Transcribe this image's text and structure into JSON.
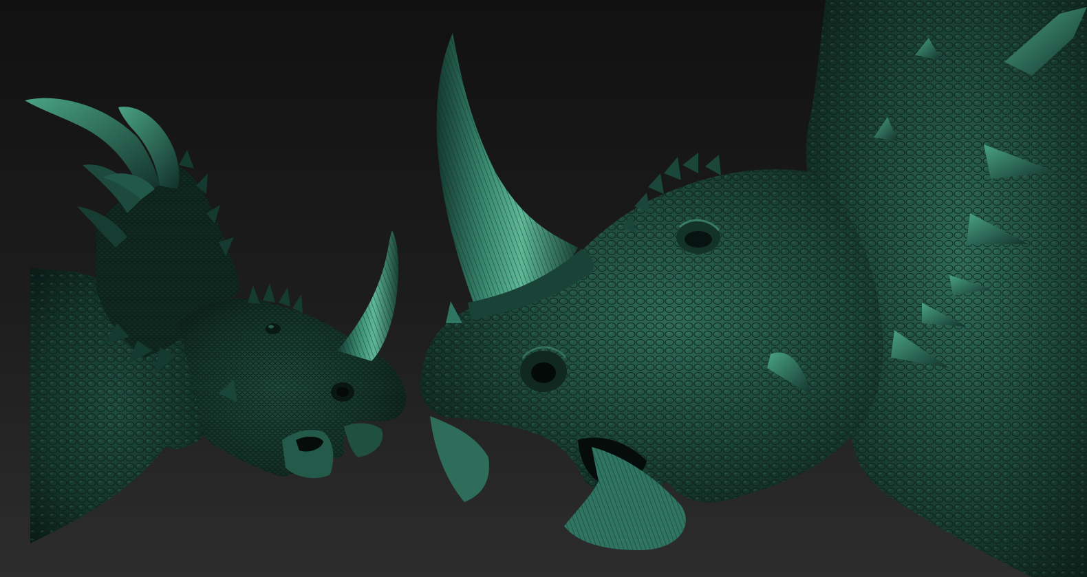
{
  "scene": {
    "subjects": [
      {
        "kind": "ceratopsian-head-bust",
        "view": "three-quarter"
      },
      {
        "kind": "ceratopsian-head-bust",
        "view": "close-up-profile"
      }
    ]
  },
  "colors": {
    "background_top": "#121212",
    "background_bottom": "#2b2b2b",
    "skin_dark": "#0c1b17",
    "skin_mid": "#1d4a3c",
    "skin_light": "#3f8f76",
    "highlight": "#6ec9a9"
  }
}
